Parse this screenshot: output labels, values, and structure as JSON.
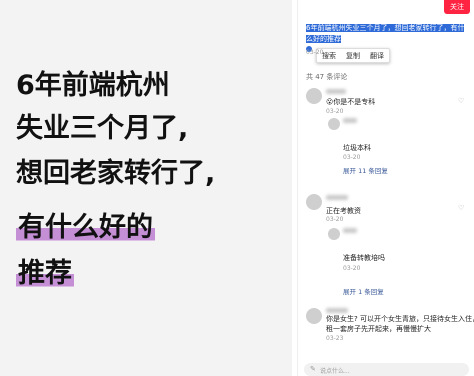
{
  "cover": {
    "lines": [
      "6年前端杭州",
      "失业三个月了,",
      "想回老家转行了,",
      "有什么好的",
      "推荐"
    ]
  },
  "post": {
    "follow_label": "关注",
    "selected_text": "6年前端杭州失业三个月了，想回老家转行了，有什么好的推荐",
    "context_menu": [
      "搜索",
      "复制",
      "翻译"
    ],
    "date": "03-20",
    "comment_count": "共 47 条评论"
  },
  "comments": [
    {
      "text": "你是不是专科",
      "date": "03-20",
      "reply": {
        "text": "垃圾本科",
        "date": "03-20"
      },
      "expand": "展开 11 条回复"
    },
    {
      "text": "正在考教资",
      "date": "03-20",
      "reply": {
        "text": "准备转教培吗",
        "date": "03-20"
      },
      "expand": "展开 1 条回复"
    },
    {
      "text": "你是女生? 可以开个女生青旅，只接待女生入住，前期",
      "text2": "租一套房子先开起来，再慢慢扩大",
      "date": "03-23"
    }
  ],
  "input": {
    "placeholder": "说点什么..."
  },
  "icons": {
    "pencil": "pencil-icon",
    "heart": "heart-icon"
  },
  "colors": {
    "accent": "#ff2442",
    "selection": "#2f6bd8",
    "highlight": "#c58fd6"
  }
}
